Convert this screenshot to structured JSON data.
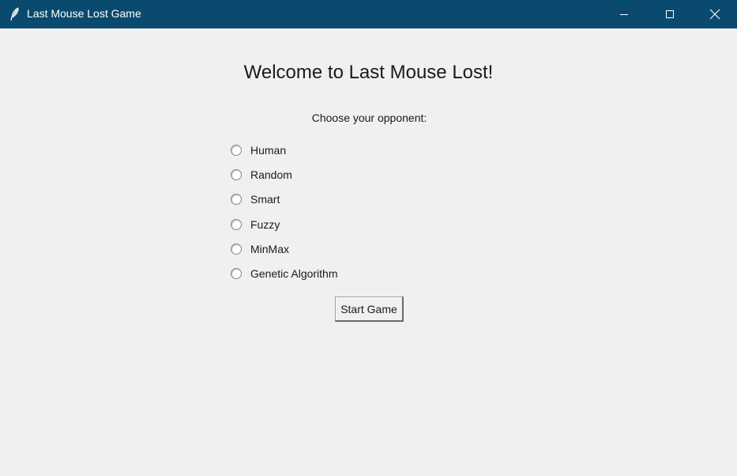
{
  "window": {
    "title": "Last Mouse Lost Game",
    "titlebar_color": "#0b4a6f",
    "background_color": "#f0f0f0",
    "icon": "feather-icon",
    "controls": [
      "minimize-icon",
      "maximize-icon",
      "close-icon"
    ]
  },
  "main": {
    "heading": "Welcome to Last Mouse Lost!",
    "prompt": "Choose your opponent:",
    "options": [
      {
        "label": "Human",
        "selected": false
      },
      {
        "label": "Random",
        "selected": false
      },
      {
        "label": "Smart",
        "selected": false
      },
      {
        "label": "Fuzzy",
        "selected": false
      },
      {
        "label": "MinMax",
        "selected": false
      },
      {
        "label": "Genetic Algorithm",
        "selected": false
      }
    ],
    "start_button": "Start Game"
  }
}
